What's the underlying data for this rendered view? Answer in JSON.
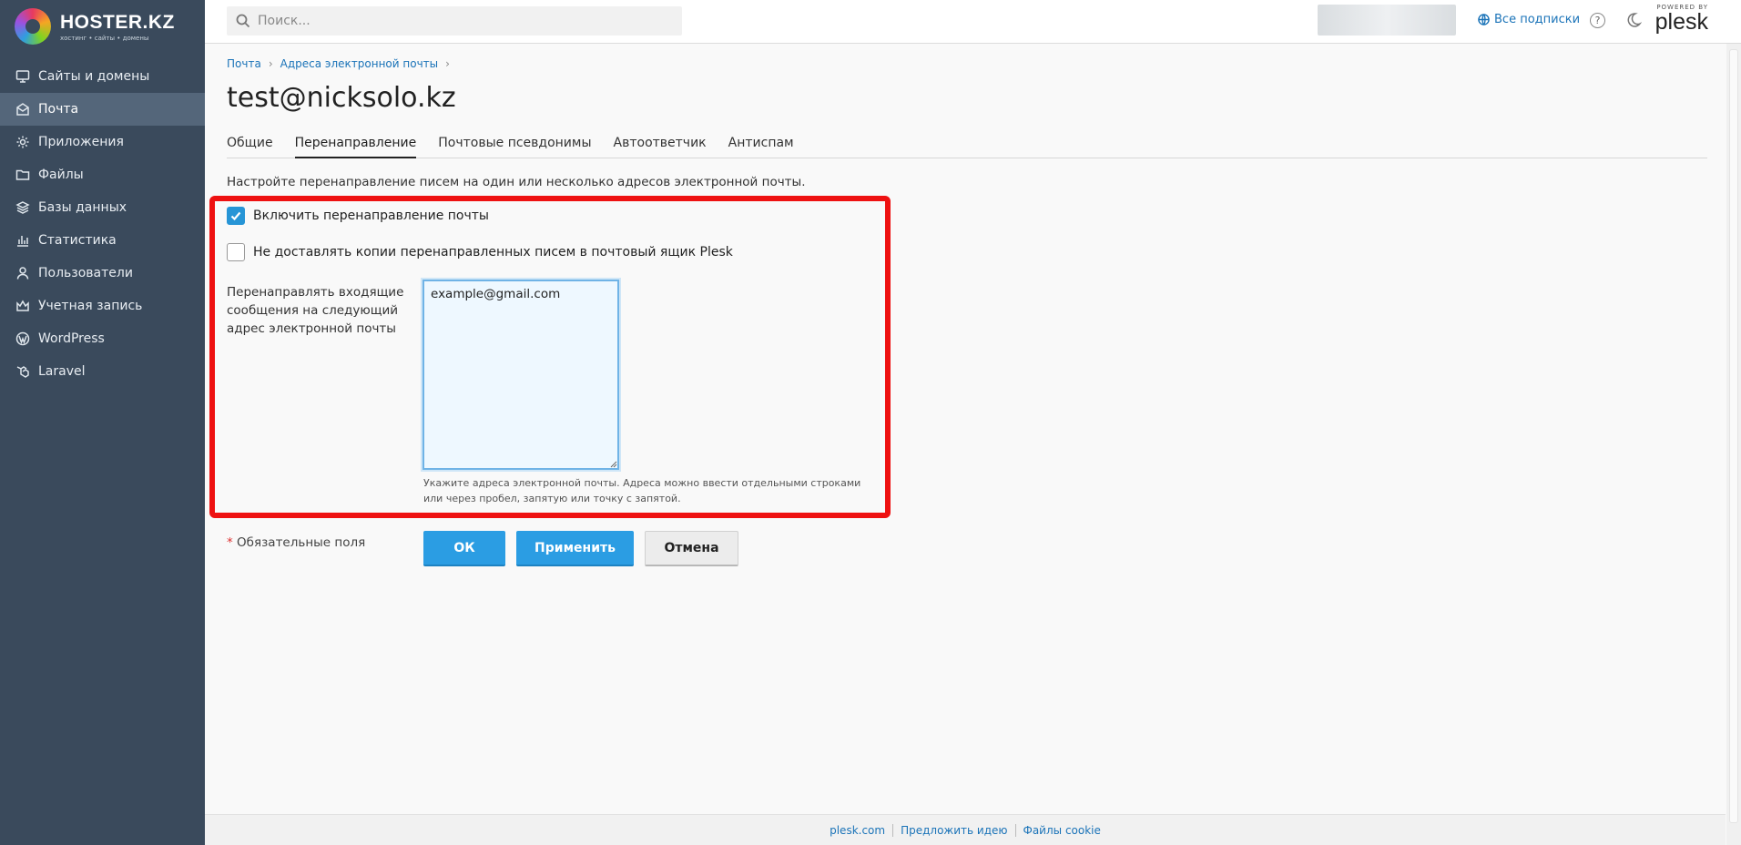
{
  "brand": {
    "name": "HOSTER.KZ",
    "tagline": "хостинг • сайты • домены"
  },
  "sidebar": {
    "items": [
      {
        "label": "Сайты и домены",
        "icon": "monitor-icon",
        "active": false
      },
      {
        "label": "Почта",
        "icon": "mail-icon",
        "active": true
      },
      {
        "label": "Приложения",
        "icon": "gear-icon",
        "active": false
      },
      {
        "label": "Файлы",
        "icon": "folder-icon",
        "active": false
      },
      {
        "label": "Базы данных",
        "icon": "database-icon",
        "active": false
      },
      {
        "label": "Статистика",
        "icon": "bar-chart-icon",
        "active": false
      },
      {
        "label": "Пользователи",
        "icon": "user-icon",
        "active": false
      },
      {
        "label": "Учетная запись",
        "icon": "crown-icon",
        "active": false
      },
      {
        "label": "WordPress",
        "icon": "wordpress-icon",
        "active": false
      },
      {
        "label": "Laravel",
        "icon": "laravel-icon",
        "active": false
      }
    ]
  },
  "header": {
    "search_placeholder": "Поиск...",
    "subscriptions_label": "Все подписки",
    "help_glyph": "?",
    "plesk_powered": "POWERED BY",
    "plesk_word": "plesk"
  },
  "breadcrumb": [
    "Почта",
    "Адреса электронной почты"
  ],
  "page_title": "test@nicksolo.kz",
  "tabs": [
    {
      "label": "Общие",
      "active": false
    },
    {
      "label": "Перенаправление",
      "active": true
    },
    {
      "label": "Почтовые псевдонимы",
      "active": false
    },
    {
      "label": "Автоответчик",
      "active": false
    },
    {
      "label": "Антиспам",
      "active": false
    }
  ],
  "description": "Настройте перенаправление писем на один или несколько адресов электронной почты.",
  "form": {
    "enable_forwarding": {
      "label": "Включить перенаправление почты",
      "checked": true
    },
    "no_copies": {
      "label": "Не доставлять копии перенаправленных писем в почтовый ящик Plesk",
      "checked": false
    },
    "forward_to": {
      "label": "Перенаправлять входящие сообщения на следующий адрес электронной почты",
      "value": "example@gmail.com",
      "hint": "Укажите адреса электронной почты. Адреса можно ввести отдельными строками или через пробел, запятую или точку с запятой."
    }
  },
  "required_note": {
    "star": "*",
    "text": "Обязательные поля"
  },
  "buttons": {
    "ok": "ОК",
    "apply": "Применить",
    "cancel": "Отмена"
  },
  "footer": {
    "links": [
      "plesk.com",
      "Предложить идею",
      "Файлы cookie"
    ]
  },
  "colors": {
    "sidebar_bg": "#3a4a5c",
    "accent": "#2b9de3",
    "highlight": "#ee1111"
  }
}
